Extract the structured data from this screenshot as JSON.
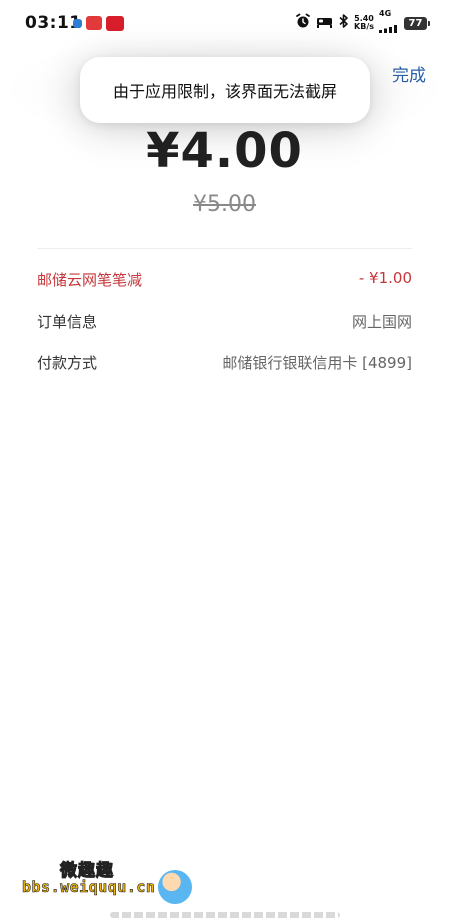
{
  "status_bar": {
    "time": "03:11",
    "speed_top": "5.40",
    "speed_bottom": "KB/s",
    "network": "4G",
    "battery": "77"
  },
  "header": {
    "done_label": "完成"
  },
  "toast": {
    "message": "由于应用限制，该界面无法截屏"
  },
  "payment": {
    "amount": "¥4.00",
    "original_amount": "¥5.00"
  },
  "details": {
    "discount_label": "邮储云网笔笔减",
    "discount_value": "- ¥1.00",
    "order_label": "订单信息",
    "order_value": "网上国网",
    "method_label": "付款方式",
    "method_value": "邮储银行银联信用卡 [4899]"
  },
  "watermark": {
    "top_text": "微趣趣",
    "url": "bbs.weiququ.cn"
  },
  "colors": {
    "accent_link": "#2a5fa8",
    "discount_red": "#c6363a",
    "strike_gray": "#8a8a8a"
  },
  "icons": {
    "alarm": "alarm-icon",
    "bed": "sleep-mode-icon",
    "bluetooth": "bluetooth-icon",
    "signal": "signal-icon"
  }
}
